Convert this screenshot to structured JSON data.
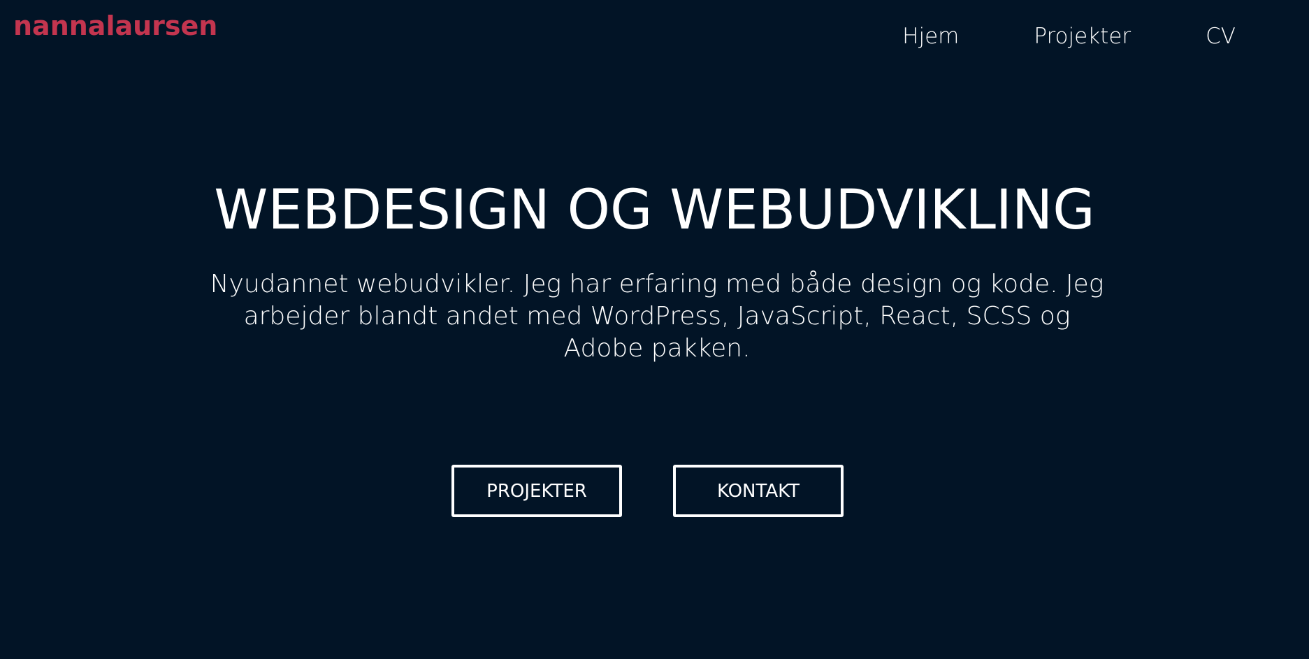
{
  "header": {
    "logo_text": "nannalaursen",
    "nav": [
      {
        "label": "Hjem"
      },
      {
        "label": "Projekter"
      },
      {
        "label": "CV"
      }
    ]
  },
  "hero": {
    "title": "WEBDESIGN OG WEBUDVIKLING",
    "description": "Nyudannet webudvikler. Jeg har erfaring med både design og kode. Jeg arbejder blandt andet med WordPress, JavaScript, React, SCSS og Adobe pakken.",
    "buttons": [
      {
        "label": "PROJEKTER"
      },
      {
        "label": "KONTAKT"
      }
    ]
  },
  "colors": {
    "background": "#021426",
    "logo": "#c3354f",
    "text": "#ffffff"
  }
}
